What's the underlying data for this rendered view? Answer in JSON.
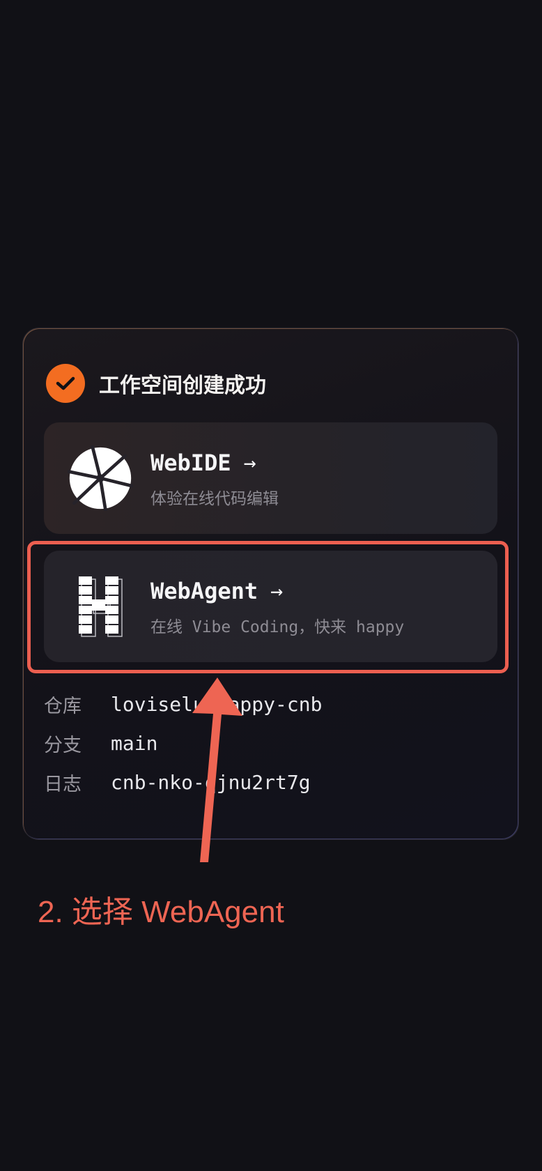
{
  "dialog": {
    "title": "工作空间创建成功",
    "icons": {
      "status": "check-icon"
    }
  },
  "options": {
    "webide": {
      "title": "WebIDE",
      "arrow": "→",
      "subtitle": "体验在线代码编辑",
      "icon": "webide-logo-icon"
    },
    "webagent": {
      "title": "WebAgent",
      "arrow": "→",
      "subtitle": "在线 Vibe Coding，快来 happy",
      "icon": "webagent-logo-icon"
    }
  },
  "info": {
    "repo_label": "仓库",
    "repo_value": "loviselu/happy-cnb",
    "branch_label": "分支",
    "branch_value": "main",
    "log_label": "日志",
    "log_value": "cnb-nko-qjnu2rt7g"
  },
  "annotation": {
    "text": "2. 选择 WebAgent",
    "color": "#ee6553"
  },
  "colors": {
    "accent": "#f36d21",
    "highlight": "#ec5f50",
    "background": "#111116"
  }
}
